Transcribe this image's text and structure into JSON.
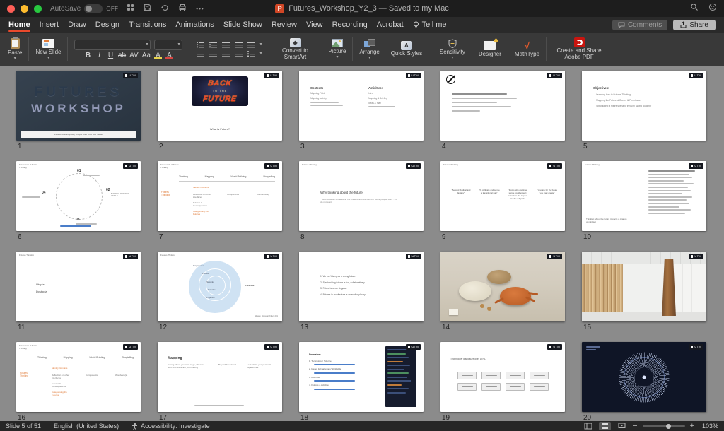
{
  "common": {
    "badge": "UTM"
  },
  "titlebar": {
    "autosave_label": "AutoSave",
    "autosave_state": "OFF",
    "doc_title": "Futures_Workshop_Y2_3 — Saved to my Mac"
  },
  "tabs": {
    "home": "Home",
    "insert": "Insert",
    "draw": "Draw",
    "design": "Design",
    "transitions": "Transitions",
    "animations": "Animations",
    "slideshow": "Slide Show",
    "review": "Review",
    "view": "View",
    "recording": "Recording",
    "acrobat": "Acrobat",
    "tellme": "Tell me",
    "comments": "Comments",
    "share": "Share"
  },
  "ribbon": {
    "paste": "Paste",
    "new_slide": "New Slide",
    "bold": "B",
    "italic": "I",
    "underline": "U",
    "strike": "ab",
    "kern": "AV",
    "case": "Aa",
    "highlight": "A",
    "font_color": "A",
    "convert_smartart": "Convert to SmartArt",
    "picture": "Picture",
    "arrange": "Arrange",
    "quick_styles": "Quick Styles",
    "sensitivity": "Sensitivity",
    "designer": "Designer",
    "mathtype": "MathType",
    "adobe_pdf": "Create and Share Adobe PDF"
  },
  "statusbar": {
    "slide_info": "Slide 5 of 51",
    "language": "English (United States)",
    "accessibility": "Accessibility: Investigate",
    "zoom": "103%"
  },
  "slides": [
    {
      "number": "1",
      "line1": "FUTURES",
      "line2": "WORKSHOP",
      "footer": "Futures Workshop AR | 10 April 2025 | 2nd Year Studio"
    },
    {
      "number": "2",
      "logo_top": "BACK",
      "logo_mid": "TO THE",
      "logo_bot": "FUTURE",
      "caption": "What is Future?"
    },
    {
      "number": "3",
      "left_title": "Contents",
      "left_items": [
        "Mapping Field",
        "Mapping activity"
      ],
      "right_title": "Activities:",
      "right_items": [
        "Intro",
        "Mapping & Briefing",
        "Ideas & Plan"
      ]
    },
    {
      "number": "4"
    },
    {
      "number": "5",
      "title": "Objectives:",
      "bullets": [
        "Learning how to Futures Thinking",
        "Mapping the Future of Border & Permission",
        "Speculating a future scenario through 'World Building'"
      ]
    },
    {
      "number": "6",
      "corner": "Framework of Future Thinking",
      "n1": "01",
      "n2": "02",
      "n3": "03",
      "n4": "04",
      "l2": "BUILDING FUTURES WORLD"
    },
    {
      "number": "7",
      "corner": "Framework of Future Thinking",
      "headers": [
        "Thinking",
        "Mapping",
        "World Building",
        "Storytelling"
      ],
      "row_label": "Futures Thinking",
      "cells": [
        "Identify Domains",
        "Reflection on other interfaces",
        "Futures & Consequences",
        "Categorising the Futures"
      ],
      "col3": "Components",
      "col4": "Worldview(s)"
    },
    {
      "number": "8",
      "corner": "Futures Thinking",
      "title": "Why thinking about the future:",
      "body": "* tools to better understand the present and discuss the future people want ... or do not want"
    },
    {
      "number": "9",
      "corner": "Futures Thinking",
      "quotes": [
        "“Beyond Radical and fantasy”",
        "“To cultivate and sense a transitional way”",
        "“Focus with continue sense could expect and share the impact for the subject”",
        "“prepare for the future you may create”"
      ]
    },
    {
      "number": "10",
      "corner": "Futures Thinking",
      "caption": "Thinking about the future impacts a change of mindset"
    },
    {
      "number": "11",
      "corner": "Futures Thinking",
      "word1": "Utopia",
      "word2": "Dystopia"
    },
    {
      "number": "12",
      "corner": "Futures Thinking",
      "labels": [
        "Preposterous",
        "Possible",
        "Plausible",
        "Probable",
        "Projected",
        "Preferable"
      ],
      "caption": "Where: Voros architect 201"
    },
    {
      "number": "13",
      "items": [
        "We can't bring as a wrong future.",
        "Synthesizing futures is fun, collaboratively.",
        "Future is never singular.",
        "Futures in architecture is cross disciplinary."
      ]
    },
    {
      "number": "14"
    },
    {
      "number": "15"
    },
    {
      "number": "16",
      "corner": "Framework of Future Thinking",
      "headers": [
        "Thinking",
        "Mapping",
        "World Building",
        "Storytelling"
      ],
      "row_label": "Futures Thinking",
      "cells": [
        "Identify Domains",
        "Reflection on other interfaces",
        "Futures & Consequences",
        "Categorising the Futures"
      ],
      "col3": "Components",
      "col4": "Worldview(s)"
    },
    {
      "number": "17",
      "title": "Mapping",
      "line1": "Seeing where you want to go, where to start and where are you heading",
      "line2": "Beyond Freedom?",
      "line3": "Look within your personal experiences."
    },
    {
      "number": "18",
      "title": "Domains:",
      "items": [
        "Technology / Science",
        "Issues & Challenges Worldwide",
        "Business",
        "Futures & Activities"
      ]
    },
    {
      "number": "19",
      "title": "Technology disclosure over LTRL"
    },
    {
      "number": "20"
    }
  ]
}
